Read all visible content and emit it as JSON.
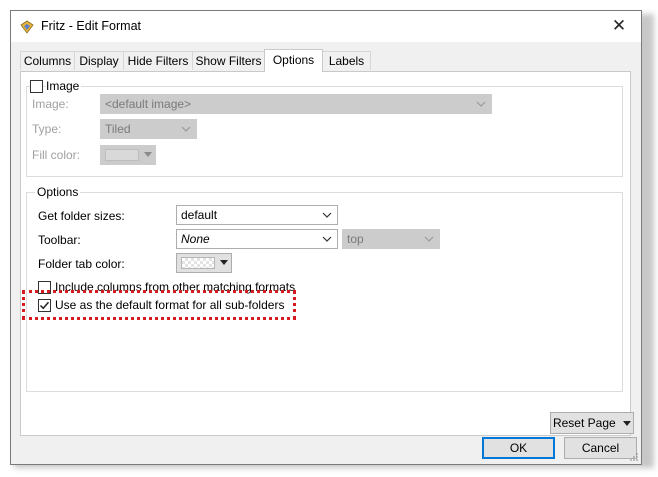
{
  "window": {
    "title": "Fritz - Edit Format",
    "close_glyph": "✕"
  },
  "tabs": [
    {
      "label": "Columns"
    },
    {
      "label": "Display"
    },
    {
      "label": "Hide Filters"
    },
    {
      "label": "Show Filters"
    },
    {
      "label": "Options",
      "active": true
    },
    {
      "label": "Labels"
    }
  ],
  "image_group": {
    "checkbox_label": "Image",
    "checked": false,
    "image_label": "Image:",
    "image_value": "<default image>",
    "type_label": "Type:",
    "type_value": "Tiled",
    "fill_label": "Fill color:"
  },
  "options_group": {
    "legend": "Options",
    "folder_sizes_label": "Get folder sizes:",
    "folder_sizes_value": "default",
    "toolbar_label": "Toolbar:",
    "toolbar_value": "None",
    "toolbar_position_value": "top",
    "tab_color_label": "Folder tab color:",
    "include_columns_label": "Include columns from other matching formats",
    "include_columns_checked": false,
    "default_format_label": "Use as the default format for all sub-folders",
    "default_format_checked": true
  },
  "buttons": {
    "reset_page": "Reset Page",
    "ok": "OK",
    "cancel": "Cancel"
  },
  "colors": {
    "accent": "#0078d7",
    "highlight": "#d71920"
  }
}
